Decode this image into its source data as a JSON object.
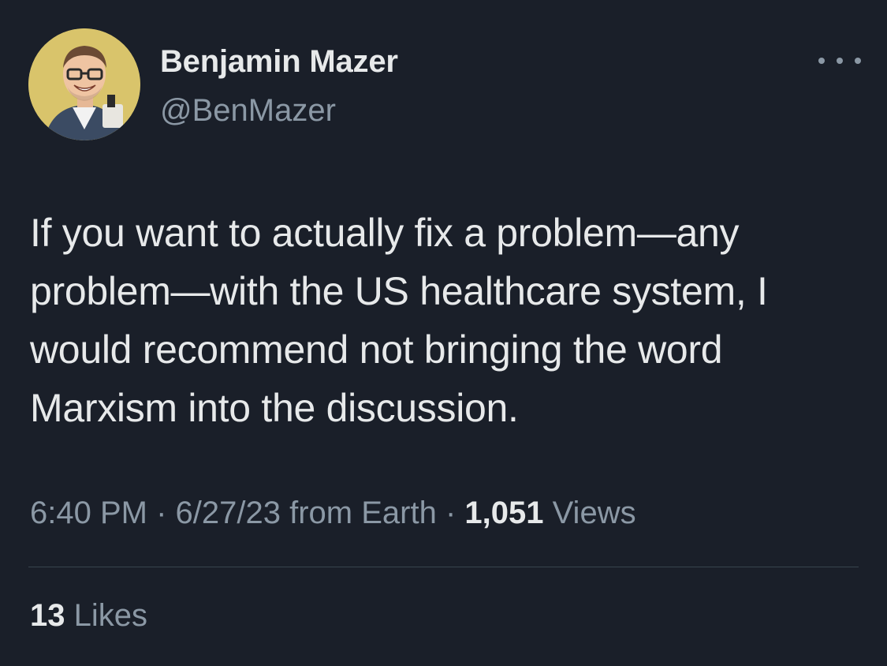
{
  "author": {
    "name": "Benjamin Mazer",
    "handle": "@BenMazer",
    "avatar_icon": "profile-photo-avatar"
  },
  "more_icon": "more-horizontal-icon",
  "tweet": {
    "lines": [
      "If you want to actually fix a problem—any",
      "problem—with the US healthcare system, I",
      "would recommend not bringing the word",
      "Marxism into the discussion."
    ]
  },
  "meta": {
    "time": "6:40 PM",
    "separator": " · ",
    "date": "6/27/23",
    "source": " from Earth",
    "views_count": "1,051",
    "views_label": " Views"
  },
  "stats": {
    "likes_count": "13",
    "likes_label": " Likes"
  },
  "colors": {
    "background": "#1a1f29",
    "primary_text": "#e7e9ea",
    "secondary_text": "#8b98a5",
    "divider": "#38444d"
  }
}
